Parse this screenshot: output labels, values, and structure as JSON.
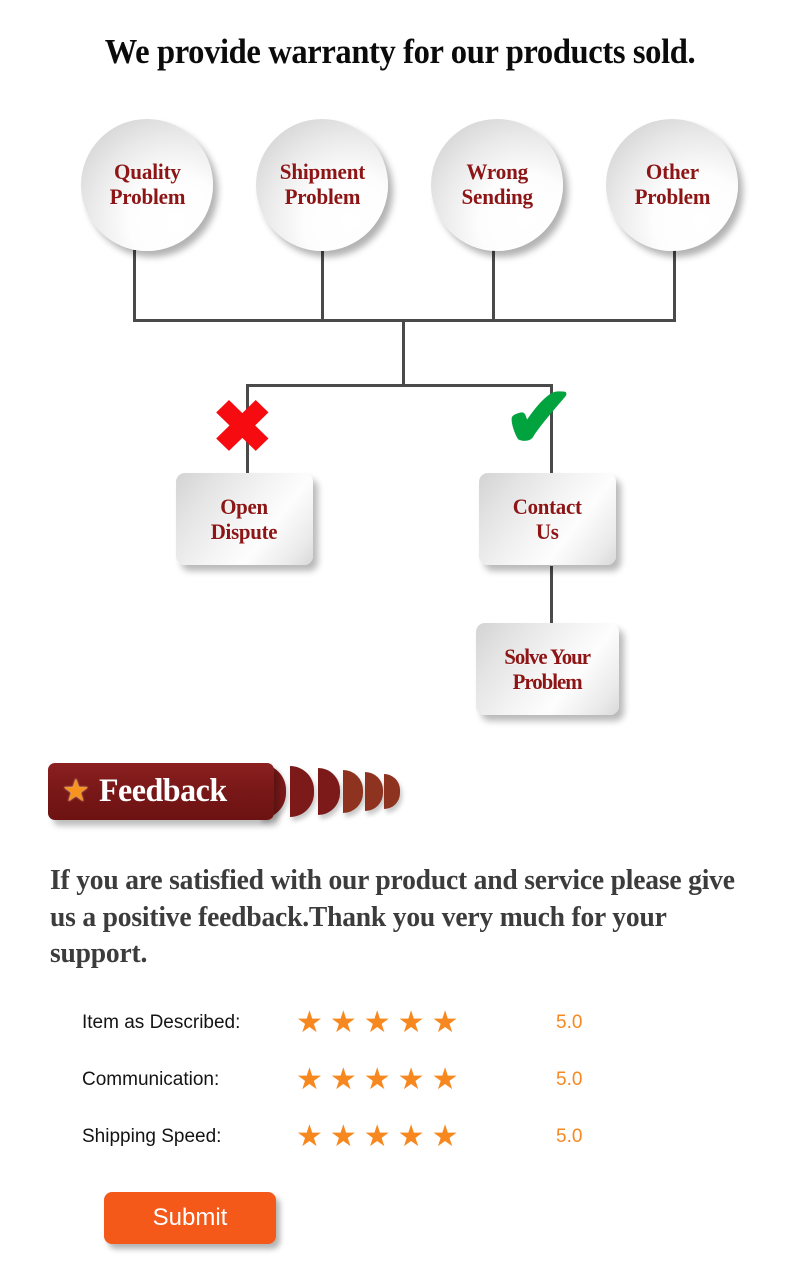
{
  "page": {
    "title": "We provide warranty for our products sold."
  },
  "diagram": {
    "problems": [
      {
        "label": "Quality\nProblem"
      },
      {
        "label": "Shipment\nProblem"
      },
      {
        "label": "Wrong\nSending"
      },
      {
        "label": "Other\nProblem"
      }
    ],
    "branches": {
      "negative_icon": "cross-mark",
      "negative_symbol": "✖",
      "positive_icon": "check-mark",
      "positive_symbol": "✔"
    },
    "boxes": {
      "open_dispute": "Open\nDispute",
      "contact_us": "Contact\nUs",
      "solve_problem": "Solve Your\nProblem"
    },
    "colors": {
      "text_red": "#8d1515",
      "cross_red": "#f60c10",
      "check_green": "#00a33d",
      "connector_gray": "#4a4a4a"
    }
  },
  "feedback": {
    "banner_label": "Feedback",
    "banner_star_symbol": "★",
    "banner_color": "#7a1818",
    "star_color": "#f7941d",
    "message": "If you are satisfied with our product and service please give us a positive feedback.Thank you very much for your support.",
    "ratings": [
      {
        "label": "Item as Described:",
        "stars": "★★★★★",
        "score": "5.0"
      },
      {
        "label": "Communication:",
        "stars": "★★★★★",
        "score": "5.0"
      },
      {
        "label": "Shipping Speed:",
        "stars": "★★★★★",
        "score": "5.0"
      }
    ],
    "submit_label": "Submit",
    "submit_color": "#f4591a"
  }
}
